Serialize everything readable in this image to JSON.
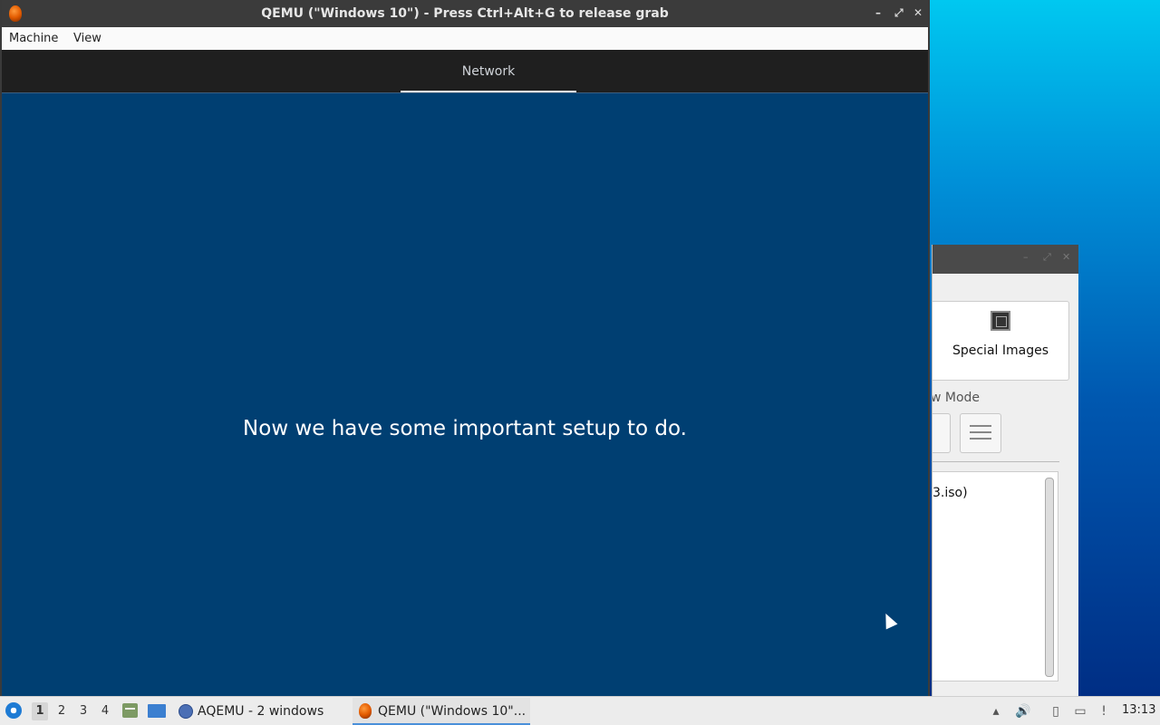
{
  "qemu": {
    "title": "QEMU (\"Windows 10\") - Press Ctrl+Alt+G to release grab",
    "menu": [
      "Machine",
      "View"
    ],
    "guest": {
      "tab": "Network",
      "message": "Now we have some important setup to do."
    }
  },
  "background_window": {
    "special_images_label": "Special Images",
    "view_mode_label": "w Mode",
    "list_item": "3.iso)"
  },
  "taskbar": {
    "workspaces": [
      "1",
      "2",
      "3",
      "4"
    ],
    "active_workspace": "1",
    "tasks": [
      {
        "label": "AQEMU - 2 windows",
        "icon": "aqemu-icon"
      },
      {
        "label": "QEMU (\"Windows 10\"...",
        "icon": "qemu-icon",
        "active": true
      }
    ],
    "clock": "13:13"
  },
  "colors": {
    "guest_background": "#003f72",
    "guest_header": "#1f1f1f",
    "titlebar": "#3b3b3b"
  }
}
